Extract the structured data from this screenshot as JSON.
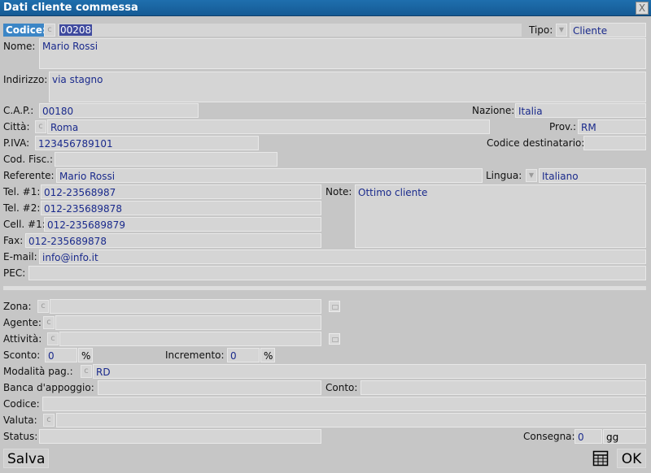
{
  "window": {
    "title": "Dati cliente commessa",
    "close": "X"
  },
  "form": {
    "codice": {
      "label": "Codice:",
      "value": "00208",
      "btn": "c"
    },
    "tipo": {
      "label": "Tipo:",
      "value": "Cliente"
    },
    "nome": {
      "label": "Nome:",
      "value": "Mario Rossi"
    },
    "indirizzo": {
      "label": "Indirizzo:",
      "value": "via stagno"
    },
    "cap": {
      "label": "C.A.P.:",
      "value": "00180"
    },
    "nazione": {
      "label": "Nazione:",
      "value": "Italia"
    },
    "citta": {
      "label": "Città:",
      "value": "Roma",
      "btn": "c"
    },
    "prov": {
      "label": "Prov.:",
      "value": "RM"
    },
    "piva": {
      "label": "P.IVA:",
      "value": "123456789101"
    },
    "codice_destinatario": {
      "label": "Codice destinatario:",
      "value": ""
    },
    "cod_fisc": {
      "label": "Cod. Fisc.:",
      "value": ""
    },
    "referente": {
      "label": "Referente:",
      "value": "Mario Rossi"
    },
    "lingua": {
      "label": "Lingua:",
      "value": "Italiano"
    },
    "tel1": {
      "label": "Tel. #1:",
      "value": "012-23568987"
    },
    "tel2": {
      "label": "Tel. #2:",
      "value": "012-235689878"
    },
    "cell1": {
      "label": "Cell. #1:",
      "value": "012-235689879"
    },
    "fax": {
      "label": "Fax:",
      "value": "012-235689878"
    },
    "note": {
      "label": "Note:",
      "value": "Ottimo cliente"
    },
    "email": {
      "label": "E-mail:",
      "value": "info@info.it"
    },
    "pec": {
      "label": "PEC:",
      "value": ""
    },
    "zona": {
      "label": "Zona:",
      "value": "",
      "btn": "c"
    },
    "agente": {
      "label": "Agente:",
      "value": "",
      "btn": "c"
    },
    "attivita": {
      "label": "Attività:",
      "value": "",
      "btn": "c"
    },
    "sconto": {
      "label": "Sconto:",
      "value": "0",
      "unit": "%"
    },
    "incremento": {
      "label": "Incremento:",
      "value": "0",
      "unit": "%"
    },
    "modalita_pag": {
      "label": "Modalità pag.:",
      "value": "RD",
      "btn": "c"
    },
    "banca": {
      "label": "Banca d'appoggio:",
      "value": ""
    },
    "conto": {
      "label": "Conto:",
      "value": ""
    },
    "codice2": {
      "label": "Codice:",
      "value": ""
    },
    "valuta": {
      "label": "Valuta:",
      "value": "",
      "btn": "c"
    },
    "status": {
      "label": "Status:",
      "value": ""
    },
    "consegna": {
      "label": "Consegna:",
      "value": "0",
      "unit": "gg"
    }
  },
  "buttons": {
    "salva": "Salva",
    "ok": "OK"
  }
}
